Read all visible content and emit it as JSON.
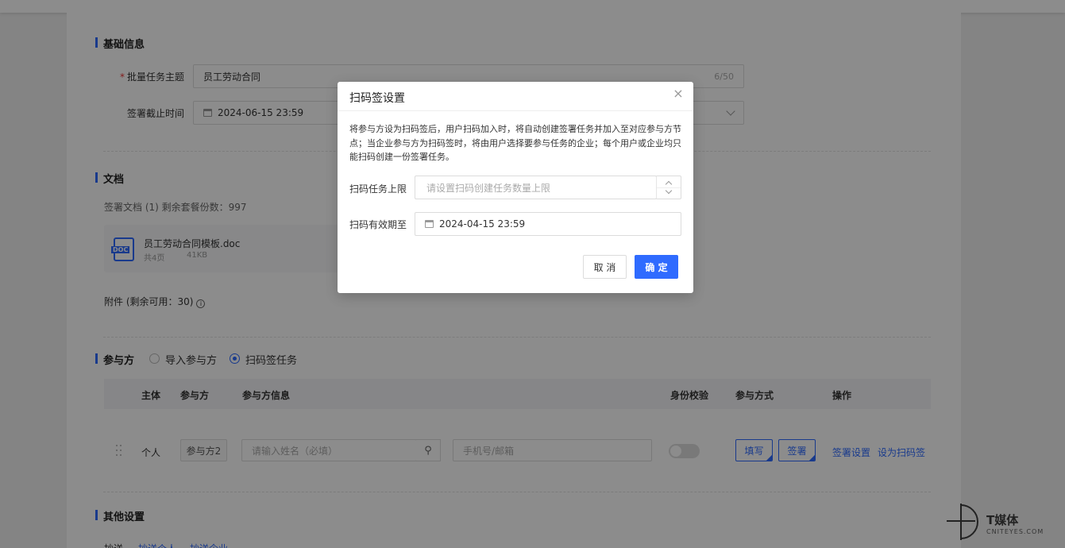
{
  "basic": {
    "title": "基础信息",
    "subject_label": "批量任务主题",
    "subject_value": "员工劳动合同",
    "subject_counter": "6/50",
    "deadline_label": "签署截止时间",
    "deadline_value": "2024-06-15 23:59"
  },
  "docs": {
    "title": "文档",
    "summary": "签署文档 (1) 剩余套餐份数：997",
    "file_name": "员工劳动合同模板.doc",
    "file_pages": "共4页",
    "file_size": "41KB",
    "file_type": "DOC",
    "attachments": "附件 (剩余可用：30)"
  },
  "participants": {
    "title": "参与方",
    "radio_import": "导入参与方",
    "radio_scan": "扫码签任务",
    "columns": [
      "主体",
      "参与方",
      "参与方信息",
      "身份校验",
      "参与方式",
      "操作"
    ],
    "row": {
      "subject": "个人",
      "party": "参与方2",
      "name_placeholder": "请输入姓名（必填）",
      "contact_placeholder": "手机号/邮箱",
      "fill_btn": "填写",
      "sign_btn": "签署",
      "action_settings": "签署设置",
      "action_scan": "设为扫码签"
    }
  },
  "other": {
    "title": "其他设置",
    "cc_label": "抄送",
    "cc_person": "抄送个人",
    "cc_company": "抄送企业"
  },
  "modal": {
    "title": "扫码签设置",
    "description": "将参与方设为扫码签后，用户扫码加入时，将自动创建签署任务并加入至对应参与方节点；当企业参与方为扫码签时，将由用户选择要参与任务的企业；每个用户或企业均只能扫码创建一份签署任务。",
    "limit_label": "扫码任务上限",
    "limit_placeholder": "请设置扫码创建任务数量上限",
    "expiry_label": "扫码有效期至",
    "expiry_value": "2024-04-15 23:59",
    "cancel": "取 消",
    "ok": "确 定"
  },
  "watermark": {
    "name": "T媒体",
    "sub": "CNITEYES.COM"
  },
  "colors": {
    "accent": "#2f6bff",
    "required": "#ee3333"
  }
}
